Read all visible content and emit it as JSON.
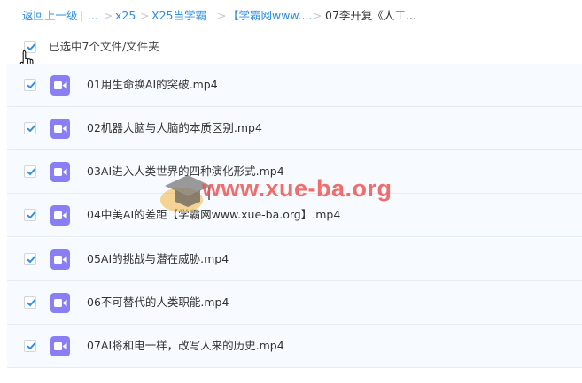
{
  "breadcrumb": {
    "back": "返回上一级",
    "sep": "|",
    "ellipsis": "...",
    "arrow": ">",
    "items": [
      "x25",
      "X25当学霸",
      "【学霸网www....",
      "07李开复《人工..."
    ]
  },
  "selection": {
    "label": "已选中7个文件/文件夹",
    "checked": true
  },
  "files": [
    {
      "name": "01用生命换AI的突破.mp4",
      "checked": true
    },
    {
      "name": "02机器大脑与人脑的本质区别.mp4",
      "checked": true
    },
    {
      "name": "03AI进入人类世界的四种演化形式.mp4",
      "checked": true
    },
    {
      "name": "04中美AI的差距【学霸网www.xue-ba.org】.mp4",
      "checked": true
    },
    {
      "name": "05AI的挑战与潜在威胁.mp4",
      "checked": true
    },
    {
      "name": "06不可替代的人类职能.mp4",
      "checked": true
    },
    {
      "name": "07AI将和电一样，改写人来的历史.mp4",
      "checked": true
    }
  ],
  "watermark": {
    "text": "www.xue-ba.org"
  },
  "colors": {
    "accent": "#2c8ee5",
    "video_icon": "#8a7ef5",
    "row_bg": "#f7fafe"
  }
}
